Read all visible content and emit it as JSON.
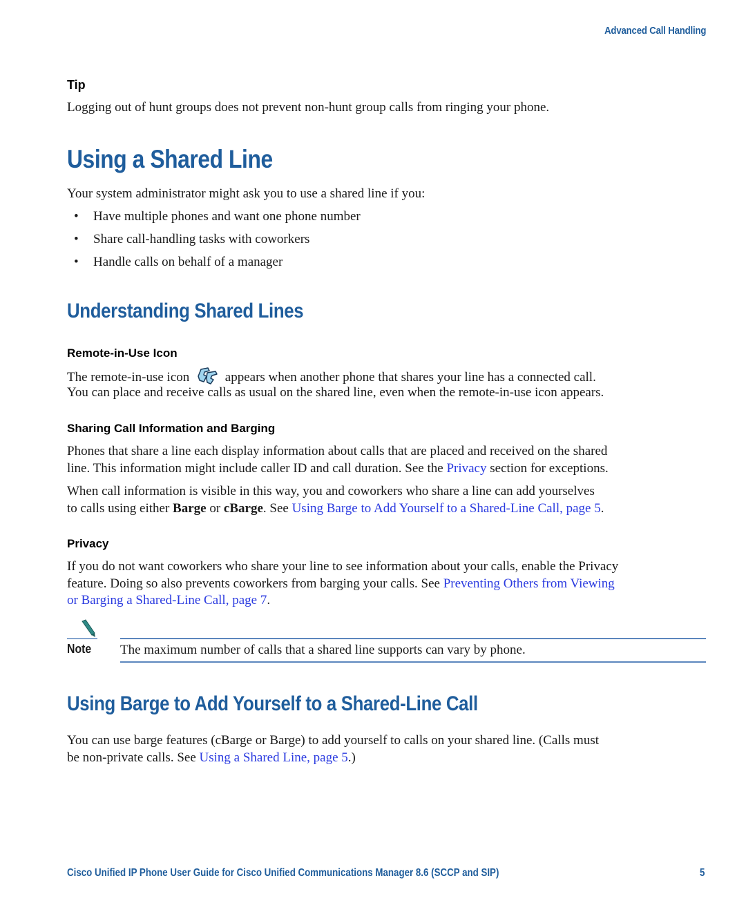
{
  "header": {
    "section_title": "Advanced Call Handling"
  },
  "tip": {
    "label": "Tip",
    "text": "Logging out of hunt groups does not prevent non-hunt group calls from ringing your phone."
  },
  "section_shared_line": {
    "title": "Using a Shared Line",
    "intro": "Your system administrator might ask you to use a shared line if you:",
    "bullets": [
      "Have multiple phones and want one phone number",
      "Share call-handling tasks with coworkers",
      "Handle calls on behalf of a manager"
    ],
    "bullet_glyph": "•"
  },
  "section_understanding": {
    "title": "Understanding Shared Lines",
    "remote_in_use": {
      "heading": "Remote-in-Use Icon",
      "line1_before": "The remote-in-use icon",
      "icon": "remote-in-use-phone-icon",
      "line1_after": "appears when another phone that shares your line has a connected call.",
      "line2": "You can place and receive calls as usual on the shared line, even when the remote-in-use icon appears."
    },
    "sharing_info": {
      "heading": "Sharing Call Information and Barging",
      "p1_line1": "Phones that share a line each display information about calls that are placed and received on the shared",
      "p1_line2_before": "line. This information might include caller ID and call duration. See the ",
      "p1_link": "Privacy",
      "p1_line2_after": " section for exceptions.",
      "p2_line1": "When call information is visible in this way, you and coworkers who share a line can add yourselves",
      "p2_line2_before": "to calls using either ",
      "p2_bold1": "Barge",
      "p2_mid": " or ",
      "p2_bold2": "cBarge",
      "p2_after": ". See ",
      "p2_link": "Using Barge to Add Yourself to a Shared-Line Call, page 5",
      "p2_end": "."
    },
    "privacy": {
      "heading": "Privacy",
      "line1": "If you do not want coworkers who share your line to see information about your calls, enable the Privacy",
      "line2_before": "feature. Doing so also prevents coworkers from barging your calls. See ",
      "link_part1": "Preventing Others from Viewing",
      "link_part2": "or Barging a Shared-Line Call, page 7",
      "line3_after": "."
    },
    "note": {
      "icon": "pencil-icon",
      "label": "Note",
      "text": "The maximum number of calls that a shared line supports can vary by phone."
    }
  },
  "section_barge": {
    "title": "Using Barge to Add Yourself to a Shared-Line Call",
    "line1": "You can use barge features (cBarge or Barge) to add yourself to calls on your shared line. (Calls must",
    "line2_before": "be non-private calls. See ",
    "link": "Using a Shared Line, page 5",
    "line2_after": ".)"
  },
  "footer": {
    "title": "Cisco Unified IP Phone User Guide for Cisco Unified Communications Manager 8.6 (SCCP and SIP)",
    "page_number": "5"
  },
  "colors": {
    "heading_blue": "#1f5d9c",
    "link_blue": "#2b3be0",
    "rule_blue": "#5b86bd"
  }
}
